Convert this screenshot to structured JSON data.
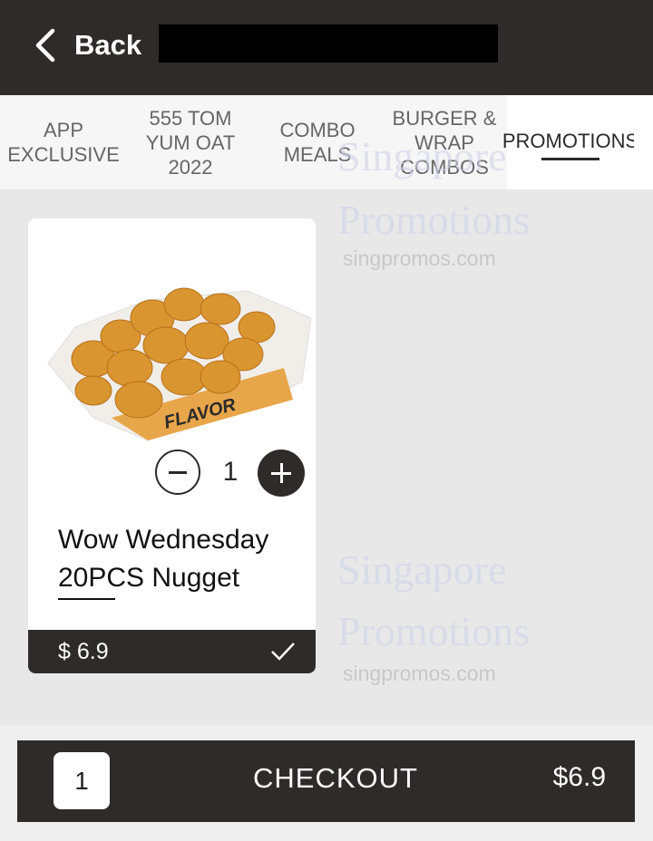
{
  "header": {
    "back_label": "Back"
  },
  "tabs": [
    {
      "label": "APP\nEXCLUSIVE",
      "active": false
    },
    {
      "label": "555 TOM\nYUM OAT\n2022",
      "active": false
    },
    {
      "label": "COMBO\nMEALS",
      "active": false
    },
    {
      "label": "BURGER &\nWRAP\nCOMBOS",
      "active": false
    },
    {
      "label": "PROMOTIONS",
      "active": true
    }
  ],
  "watermark": {
    "line1": "Singapore",
    "line2": "Promotions",
    "url": "singpromos.com"
  },
  "product": {
    "image_text": "FLAVOR",
    "quantity": "1",
    "name": "Wow Wednesday 20PCS Nugget",
    "price": "$ 6.9"
  },
  "checkout": {
    "count": "1",
    "label": "CHECKOUT",
    "total": "$6.9"
  },
  "colors": {
    "dark": "#2f2b2a",
    "tabs_bg": "#f6f6f6",
    "page_bg": "#e8e8e8"
  }
}
